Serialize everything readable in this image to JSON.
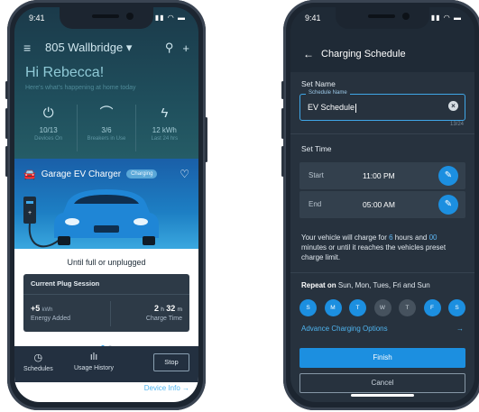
{
  "colors": {
    "accent": "#1c8fe0",
    "dark_bg": "#27323e",
    "teal": "#1f4e5c"
  },
  "left_phone": {
    "status": {
      "time": "9:41"
    },
    "nav": {
      "address": "805 Wallbridge ▾"
    },
    "greeting": "Hi Rebecca!",
    "greeting_sub": "Here's what's happening at home today",
    "stats": [
      {
        "icon": "power-icon",
        "value": "10/13",
        "label": "Devices On"
      },
      {
        "icon": "breaker-icon",
        "value": "3/6",
        "label": "Breakers in Use"
      },
      {
        "icon": "bolt-icon",
        "value": "12 kWh",
        "label": "Last 24 hrs"
      }
    ],
    "card": {
      "title": "Garage EV Charger",
      "badge": "Charging",
      "status": "Until full or unplugged",
      "session_title": "Current Plug Session",
      "energy_value": "+5",
      "energy_unit": "kWh",
      "energy_label": "Energy Added",
      "time_h": "2",
      "time_h_unit": "h",
      "time_m": "32",
      "time_m_unit": "m",
      "time_label": "Charge Time"
    },
    "actions": {
      "schedules": "Schedules",
      "usage": "Usage History",
      "stop": "Stop"
    },
    "device_info": "Device Info →"
  },
  "right_phone": {
    "status": {
      "time": "9:41"
    },
    "title": "Charging Schedule",
    "set_name": "Set Name",
    "field_label": "Schedule Name",
    "field_value": "EV Schedule",
    "counter": "13/24",
    "set_time": "Set Time",
    "start_label": "Start",
    "start_value": "11:00 PM",
    "end_label": "End",
    "end_value": "05:00 AM",
    "desc_pre": "Your vehicle will charge for ",
    "desc_hours": "6",
    "desc_mid": " hours and ",
    "desc_minutes": "00",
    "desc_post": " minutes or until it reaches the vehicles preset charge limit.",
    "repeat_label": "Repeat on",
    "repeat_days": " Sun, Mon, Tues, Fri and Sun",
    "days": [
      {
        "label": "S",
        "on": true
      },
      {
        "label": "M",
        "on": true
      },
      {
        "label": "T",
        "on": true
      },
      {
        "label": "W",
        "on": false
      },
      {
        "label": "T",
        "on": false
      },
      {
        "label": "F",
        "on": true
      },
      {
        "label": "S",
        "on": true
      }
    ],
    "advanced": "Advance Charging Options",
    "finish": "Finish",
    "cancel": "Cancel"
  }
}
